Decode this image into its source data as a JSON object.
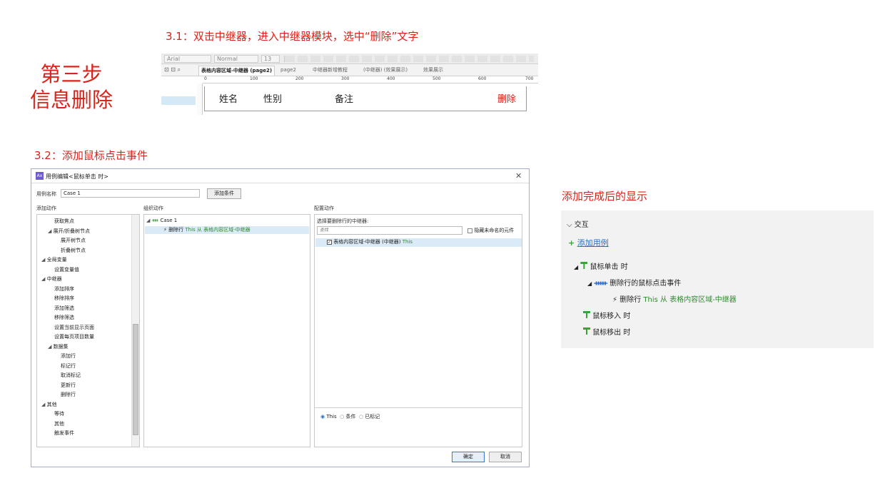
{
  "step_title": [
    "第三步",
    "信息删除"
  ],
  "captions": {
    "c1": "3.1：双击中继器，进入中继器模块，选中“删除”文字",
    "c2": "3.2：添加鼠标点击事件",
    "c3": "添加完成后的显示"
  },
  "shot1": {
    "toolbar": {
      "font": "Arial",
      "style": "Normal",
      "size": "13"
    },
    "tabs": [
      {
        "label": "表格内容区域-中继器 (page2)",
        "active": true
      },
      {
        "label": "page2",
        "active": false
      },
      {
        "label": "中继器新增教程",
        "active": false
      },
      {
        "label": "(中继器) (效果展示)",
        "active": false
      },
      {
        "label": "效果展示",
        "active": false
      }
    ],
    "ruler": [
      "0",
      "100",
      "200",
      "300",
      "400",
      "500",
      "600",
      "700"
    ],
    "table": {
      "col1": "姓名",
      "col2": "性别",
      "col3": "备注",
      "delete": "删除"
    }
  },
  "dialog": {
    "title": "用例编辑<鼠标单击 时>",
    "case_name_label": "用例名称",
    "case_name_value": "Case 1",
    "add_condition": "添加条件",
    "col_add_action": "添加动作",
    "col_organize": "组织动作",
    "col_configure": "配置动作",
    "actions": [
      {
        "label": "获取焦点",
        "indent": 2,
        "arrow": false
      },
      {
        "label": "展开/折叠树节点",
        "indent": 1,
        "arrow": true
      },
      {
        "label": "展开树节点",
        "indent": 3,
        "arrow": false
      },
      {
        "label": "折叠树节点",
        "indent": 3,
        "arrow": false
      },
      {
        "label": "全局变量",
        "indent": 0,
        "arrow": true
      },
      {
        "label": "设置变量值",
        "indent": 2,
        "arrow": false
      },
      {
        "label": "中继器",
        "indent": 0,
        "arrow": true
      },
      {
        "label": "添加排序",
        "indent": 2,
        "arrow": false
      },
      {
        "label": "移除排序",
        "indent": 2,
        "arrow": false
      },
      {
        "label": "添加筛选",
        "indent": 2,
        "arrow": false
      },
      {
        "label": "移除筛选",
        "indent": 2,
        "arrow": false
      },
      {
        "label": "设置当前显示页面",
        "indent": 2,
        "arrow": false
      },
      {
        "label": "设置每页项目数量",
        "indent": 2,
        "arrow": false
      },
      {
        "label": "数据集",
        "indent": 1,
        "arrow": true
      },
      {
        "label": "添加行",
        "indent": 3,
        "arrow": false
      },
      {
        "label": "标记行",
        "indent": 3,
        "arrow": false
      },
      {
        "label": "取消标记",
        "indent": 3,
        "arrow": false
      },
      {
        "label": "更新行",
        "indent": 3,
        "arrow": false
      },
      {
        "label": "删除行",
        "indent": 3,
        "arrow": false
      },
      {
        "label": "其他",
        "indent": 0,
        "arrow": true
      },
      {
        "label": "等待",
        "indent": 2,
        "arrow": false
      },
      {
        "label": "其他",
        "indent": 2,
        "arrow": false
      },
      {
        "label": "触发事件",
        "indent": 2,
        "arrow": false
      }
    ],
    "organize": {
      "case": "Case 1",
      "action_name": "删除行",
      "action_detail": "This 从 表格内容区域-中继器"
    },
    "configure": {
      "prompt": "选择要删除行的中继器:",
      "search_placeholder": "查找",
      "hide_unnamed": "隐藏未命名的元件",
      "item": "表格内容区域-中继器 (中继器)",
      "item_suffix": "This",
      "radios": [
        "This",
        "条件",
        "已标记"
      ]
    },
    "ok": "确定",
    "cancel": "取消"
  },
  "result_panel": {
    "section": "交互",
    "add_case": "添加用例",
    "event_click": "鼠标单击 时",
    "case_name": "删除行的鼠标点击事件",
    "action_name": "删除行",
    "action_detail": "This 从 表格内容区域-中继器",
    "event_enter": "鼠标移入 时",
    "event_leave": "鼠标移出 时"
  },
  "colors": {
    "accent_red": "#d9231b",
    "green": "#2e8b2e",
    "selection": "#dbeaf7"
  }
}
